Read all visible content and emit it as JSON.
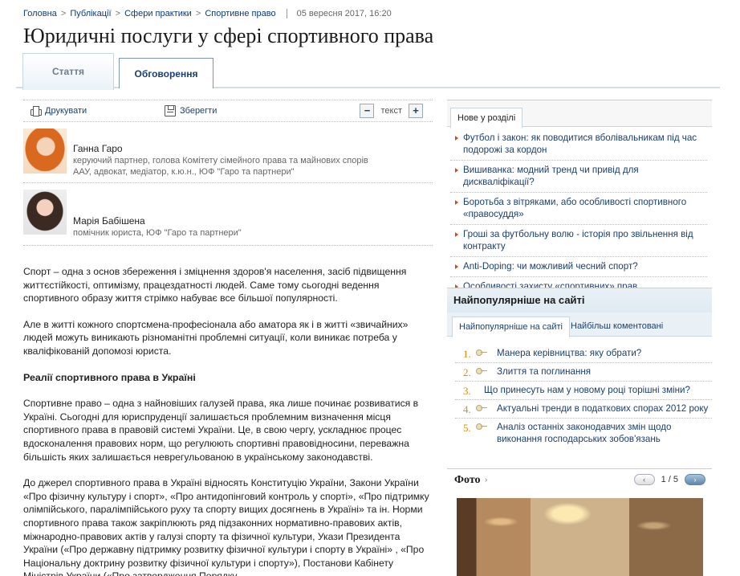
{
  "breadcrumb": {
    "items": [
      "Головна",
      "Публікації",
      "Сфери практики",
      "Спортивне право"
    ],
    "separator": ">",
    "date": "05 вересня 2017, 16:20"
  },
  "title": "Юридичні послуги у сфері спортивного права",
  "tabs": {
    "article": "Стаття",
    "discussion": "Обговорення"
  },
  "toolbar": {
    "print": "Друкувати",
    "save": "Зберегти",
    "minus": "−",
    "text": "текст",
    "plus": "+"
  },
  "authors": [
    {
      "name": "Ганна Гаро",
      "desc1": "керуючий партнер, голова Комітету сімейного права та майнових спорів",
      "desc2": "ААУ, адвокат, медіатор, к.ю.н., ЮФ \"Гаро та партнери\""
    },
    {
      "name": "Марія Бабішена",
      "desc1": "помічник юриста, ЮФ \"Гаро та партнери\""
    }
  ],
  "article": {
    "p1": "Спорт – одна з основ збереження і зміцнення здоров'я населення, засіб підвищення життєстійкості, оптимізму, працездатності людей. Саме тому сьогодні ведення спортивного образу життя стрімко набуває все більшої популярності.",
    "p2": "Але в житті кожного спортсмена-професіонала або аматора як і в житті «звичайних» людей можуть виникають різноманітні проблемні ситуації, коли виникає потреба у кваліфікованій допомозі юриста.",
    "h1": "Реалії спортивного права в Україні",
    "p3": "Спортивне право – одна з найновіших галузей права, яка лише починає розвиватися в Україні. Сьогодні для юриспруденції залишається проблемним визначення місця спортивного права в правовій системі України. Це, в свою чергу, ускладнює процес вдосконалення правових норм, що регулюють спортивні правовідносини, переважна більшість яких залишається неврегульованою в українському законодавстві.",
    "p4": "До джерел спортивного права в Україні відносять Конституцію України, Закони України «Про фізичну культуру і спорт», «Про антидопінговий контроль у спорті», «Про підтримку олімпійського, паралімпійського руху та спорту вищих досягнень в Україні» та ін. Норми спортивного права також закріплюють ряд підзаконних нормативно-правових актів, міжнародно-правових актів у галузі спорту та фізичної культури, Укази Президента України («Про державну підтримку розвитку фізичної культури і спорту в Україні» , «Про Національну доктрину розвитку фізичної культури і спорту»), Постанови Кабінету Міністрів України («Про затвердження Порядку"
  },
  "sidebar": {
    "new_tab": "Нове у розділі",
    "new_items": [
      "Футбол і закон: як поводитися вболівальникам під час подорожі за кордон",
      "Вишиванка: модний тренд чи привід для дискваліфікації?",
      "Боротьба з вітряками, або особливості спортивного «правосуддя»",
      "Гроші за футбольну волю - історія про звільнення від контракту",
      "Anti-Doping: чи можливий чесний спорт?",
      "Особливості захисту «спортивних» прав"
    ],
    "popular_title": "Найпопулярніше на сайті",
    "popular_tab_on": "Найпопулярніше на сайті",
    "popular_tab_off": "Найбільш коментовані",
    "popular": [
      {
        "num": "1.",
        "text": "Манера керівництва: яку обрати?"
      },
      {
        "num": "2.",
        "text": "Злиття та поглинання"
      },
      {
        "num": "3.",
        "text": "Що принесуть нам у новому році торішні зміни?"
      },
      {
        "num": "4.",
        "text": "Актуальні тренди в податкових спорах 2012 року"
      },
      {
        "num": "5.",
        "text": "Аналіз останніх законодавчих змін щодо виконання господарських зобов'язань"
      }
    ],
    "photo_title": "Фото",
    "photo_arrow": "›",
    "pager": "1 / 5",
    "prev": "‹",
    "next": "›"
  }
}
